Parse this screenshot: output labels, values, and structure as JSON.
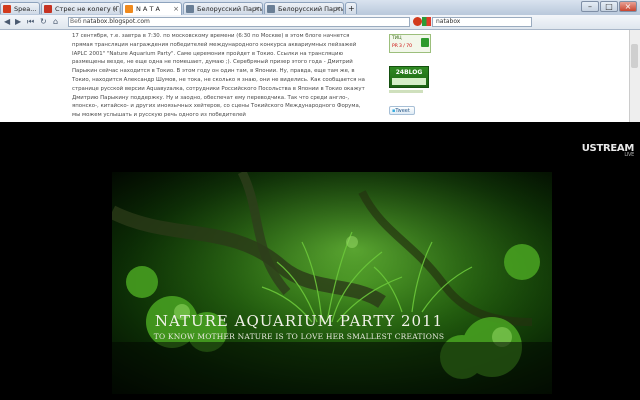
{
  "browser": {
    "tabs": [
      {
        "label": "Spea..."
      },
      {
        "label": "Стрес не колегу (Гр..."
      },
      {
        "label": "N A T A"
      },
      {
        "label": "Белорусский Партиза..."
      },
      {
        "label": "Белорусский Партиза..."
      }
    ],
    "url_label": "Веб",
    "url": "natabox.blogspot.com",
    "search": "natabox"
  },
  "article": {
    "text": "17 сентября, т.е. завтра в 7:30. по московскому времени (6:30 по Москве) в этом блоге начнется прямая трансляция награждения победителей международного конкурса аквариумных пейзажей IAPLC 2001\" \"Nature Aquarium Party\". Саме церемония пройдет в Токио. Ссылки на трансляцию размещены везде, не еще одна не помешает, думаю ;). Серебряный призер этого года - Дмитрий Парыкин сейчас находится в Токио. В этом году он один там, в Японии. Ну, правда, еще там же, в Токио, находится Александр Шумов, не тока, не сколько я знаю, они не виделись. Как сообщается на странице русской версии Aquaвуzалка, сотрудники Российского Посольства в Японии в Токио окажут Дмитрию Парыкину поддержку. Ну и заодно, обеспечат ему переводчика. Так что среди англо-, японско-, китайско- и других иноязычных хейтеров, со сцены Токийского Международного Форума, мы можем услышать и русскую речь одного из победителей"
  },
  "sidebar": {
    "widget1_top": "ТИЦ",
    "widget1_mid": "PR",
    "widget1_val": "3 / 70",
    "widget2_top": "24BLOG",
    "widget2_mid": "",
    "widget3": "",
    "tweet": "Tweet"
  },
  "video": {
    "title": "NATURE AQUARIUM PARTY 2011",
    "subtitle": "TO KNOW MOTHER NATURE IS TO LOVE HER SMALLEST CREATIONS",
    "brand": "USTREAM",
    "brand_sub": "LIVE"
  },
  "colors": {
    "accent": "#cc3a00",
    "leaf": "#3e8f1a"
  }
}
